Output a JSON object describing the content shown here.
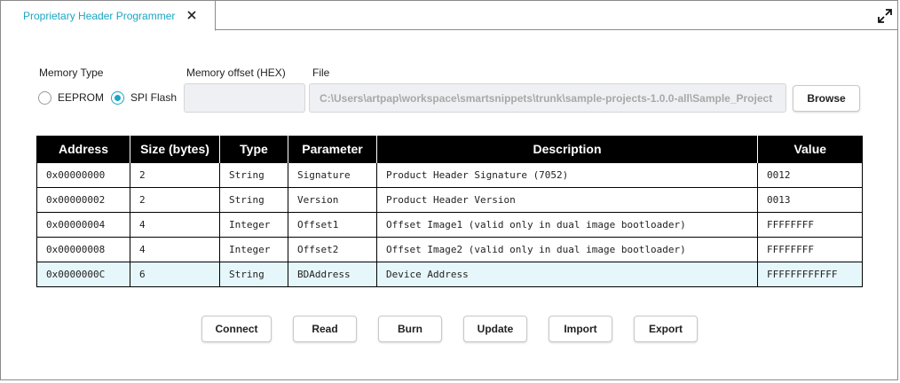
{
  "tab": {
    "title": "Proprietary Header Programmer"
  },
  "memory_type": {
    "label": "Memory Type",
    "options": [
      "EEPROM",
      "SPI Flash"
    ],
    "selected": "SPI Flash"
  },
  "memory_offset": {
    "label": "Memory offset (HEX)",
    "value": ""
  },
  "file": {
    "label": "File",
    "value": "C:\\Users\\artpap\\workspace\\smartsnippets\\trunk\\sample-projects-1.0.0-all\\Sample_Project",
    "browse_label": "Browse"
  },
  "table": {
    "columns": [
      "Address",
      "Size (bytes)",
      "Type",
      "Parameter",
      "Description",
      "Value"
    ],
    "rows": [
      [
        "0x00000000",
        "2",
        "String",
        "Signature",
        "Product Header Signature (7052)",
        "0012"
      ],
      [
        "0x00000002",
        "2",
        "String",
        "Version",
        "Product Header Version",
        "0013"
      ],
      [
        "0x00000004",
        "4",
        "Integer",
        "Offset1",
        "Offset Image1 (valid only in dual image bootloader)",
        "FFFFFFFF"
      ],
      [
        "0x00000008",
        "4",
        "Integer",
        "Offset2",
        "Offset Image2 (valid only in dual image bootloader)",
        "FFFFFFFF"
      ],
      [
        "0x0000000C",
        "6",
        "String",
        "BDAddress",
        "Device Address",
        "FFFFFFFFFFFF"
      ]
    ],
    "selected_row": 4
  },
  "actions": {
    "connect": "Connect",
    "read": "Read",
    "burn": "Burn",
    "update": "Update",
    "import": "Import",
    "export": "Export"
  },
  "colors": {
    "accent": "#1ba6c4",
    "header_bg": "#000000",
    "selected_row": "#e6f7fb"
  }
}
